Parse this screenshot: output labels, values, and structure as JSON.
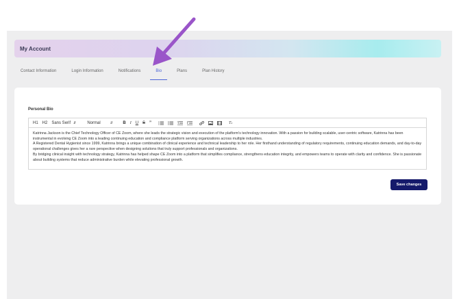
{
  "header": {
    "title": "My Account"
  },
  "tabs": [
    {
      "label": "Contact Information",
      "active": false
    },
    {
      "label": "Login Information",
      "active": false
    },
    {
      "label": "Notifications",
      "active": false
    },
    {
      "label": "Bio",
      "active": true
    },
    {
      "label": "Plans",
      "active": false
    },
    {
      "label": "Plan History",
      "active": false
    }
  ],
  "bio": {
    "section_label": "Personal Bio",
    "toolbar": {
      "h1": "H1",
      "h2": "H2",
      "font_select": "Sans Serif",
      "size_select": "Normal",
      "icons": [
        "bold-icon",
        "italic-icon",
        "underline-icon",
        "strikethrough-icon",
        "quote-icon",
        "ordered-list-icon",
        "bullet-list-icon",
        "indent-decrease-icon",
        "indent-increase-icon",
        "link-icon",
        "image-icon",
        "video-icon",
        "clear-format-icon"
      ]
    },
    "paragraphs": [
      "Katrinna Jackson is the Chief Technology Officer of CE Zoom, where she leads the strategic vision and execution of the platform's technology innovation. With a passion for building scalable, user-centric software, Katrinna has been instrumental in evolving CE Zoom into a leading continuing education and compliance platform serving organizations across multiple industries.",
      "A Registered Dental Hygienist since 1999, Katrinna brings a unique combination of clinical experience and technical leadership to her role. Her firsthand understanding of regulatory requirements, continuing education demands, and day-to-day operational challenges gives her a rare perspective when designing solutions that truly support professionals and organizations.",
      "By bridging clinical insight with technology strategy, Katrinna has helped shape CE Zoom into a platform that simplifies compliance, strengthens education integrity, and empowers teams to operate with clarity and confidence. She is passionate about building systems that reduce administrative burden while elevating professional growth."
    ],
    "save_label": "Save changes"
  },
  "colors": {
    "accent": "#4b64d6",
    "button": "#151a6b",
    "arrow": "#9a55c9"
  }
}
